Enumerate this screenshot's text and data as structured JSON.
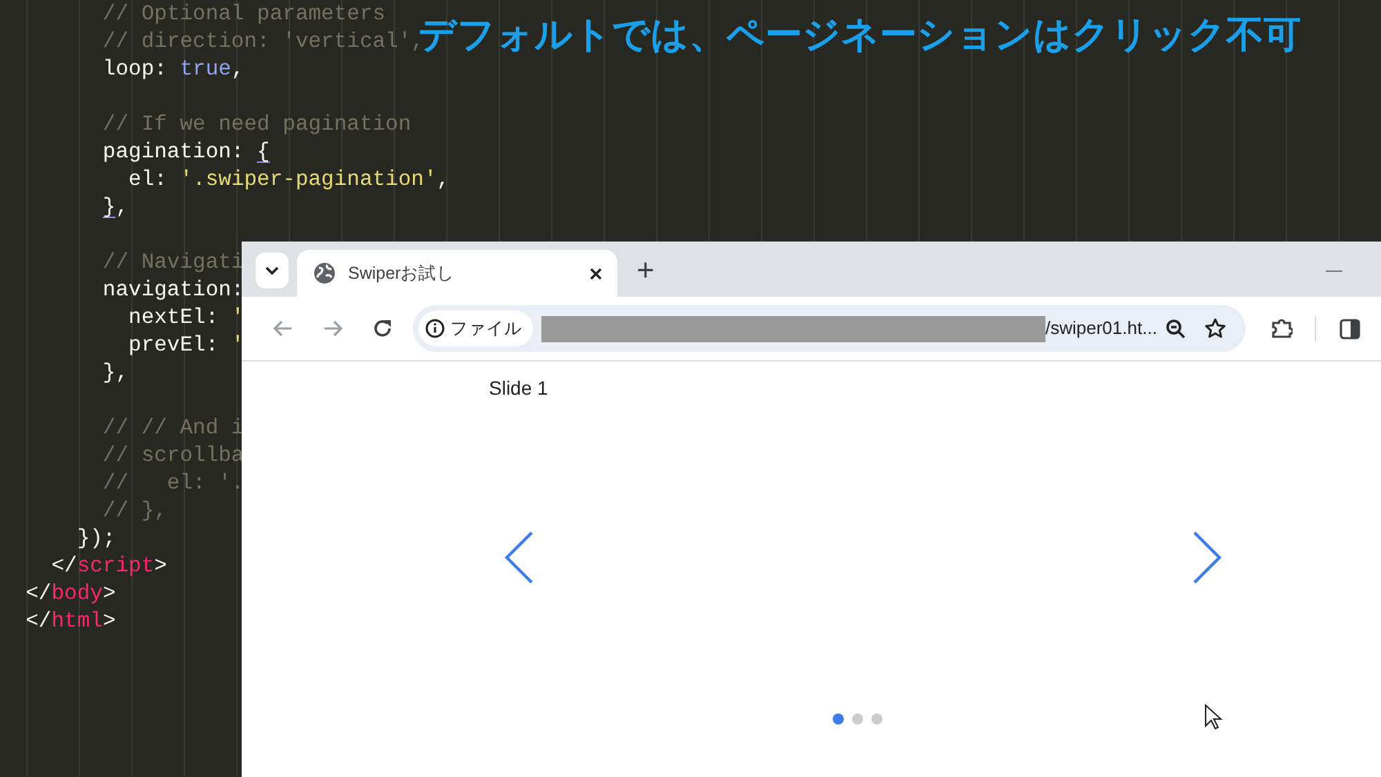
{
  "editor": {
    "lines": [
      {
        "kind": "code",
        "tokens": [
          {
            "kind": "comment",
            "text": "        // Optional parameters"
          }
        ]
      },
      {
        "kind": "code",
        "tokens": [
          {
            "kind": "comment",
            "text": "        // direction: 'vertical',"
          }
        ]
      },
      {
        "kind": "code",
        "tokens": [
          {
            "kind": "plain",
            "text": "        loop: "
          },
          {
            "kind": "keyword",
            "text": "true"
          },
          {
            "kind": "plain",
            "text": ","
          }
        ]
      },
      {
        "kind": "blank"
      },
      {
        "kind": "code",
        "tokens": [
          {
            "kind": "comment",
            "text": "        // If we need pagination"
          }
        ]
      },
      {
        "kind": "code",
        "tokens": [
          {
            "kind": "plain",
            "text": "        pagination: "
          },
          {
            "kind": "match",
            "text": "{"
          }
        ]
      },
      {
        "kind": "code",
        "tokens": [
          {
            "kind": "plain",
            "text": "          el: "
          },
          {
            "kind": "string",
            "text": "'.swiper-pagination'"
          },
          {
            "kind": "plain",
            "text": ","
          }
        ]
      },
      {
        "kind": "code",
        "tokens": [
          {
            "kind": "match",
            "text": "        }"
          },
          {
            "kind": "plain",
            "text": ","
          }
        ]
      },
      {
        "kind": "blank"
      },
      {
        "kind": "code",
        "tokens": [
          {
            "kind": "comment",
            "text": "        // Navigati"
          }
        ]
      },
      {
        "kind": "code",
        "tokens": [
          {
            "kind": "plain",
            "text": "        navigation:"
          }
        ]
      },
      {
        "kind": "code",
        "tokens": [
          {
            "kind": "plain",
            "text": "          nextEl: "
          },
          {
            "kind": "string",
            "text": "'"
          }
        ]
      },
      {
        "kind": "code",
        "tokens": [
          {
            "kind": "plain",
            "text": "          prevEl: "
          },
          {
            "kind": "string",
            "text": "'"
          }
        ]
      },
      {
        "kind": "code",
        "tokens": [
          {
            "kind": "plain",
            "text": "        },"
          }
        ]
      },
      {
        "kind": "blank"
      },
      {
        "kind": "code",
        "tokens": [
          {
            "kind": "comment",
            "text": "        // // And i"
          }
        ]
      },
      {
        "kind": "code",
        "tokens": [
          {
            "kind": "comment",
            "text": "        // scrollba"
          }
        ]
      },
      {
        "kind": "code",
        "tokens": [
          {
            "kind": "comment",
            "text": "        //   el: '."
          }
        ]
      },
      {
        "kind": "code",
        "tokens": [
          {
            "kind": "comment",
            "text": "        // },"
          }
        ]
      },
      {
        "kind": "code",
        "tokens": [
          {
            "kind": "plain",
            "text": "      });"
          }
        ]
      },
      {
        "kind": "code",
        "tokens": [
          {
            "kind": "plain",
            "text": "    </"
          },
          {
            "kind": "tag",
            "text": "script"
          },
          {
            "kind": "plain",
            "text": ">"
          }
        ]
      },
      {
        "kind": "code",
        "tokens": [
          {
            "kind": "plain",
            "text": "  </"
          },
          {
            "kind": "tag",
            "text": "body"
          },
          {
            "kind": "plain",
            "text": ">"
          }
        ]
      },
      {
        "kind": "code",
        "tokens": [
          {
            "kind": "plain",
            "text": "  </"
          },
          {
            "kind": "tag",
            "text": "html"
          },
          {
            "kind": "plain",
            "text": ">"
          }
        ]
      }
    ]
  },
  "caption": "デフォルトでは、ページネーションはクリック不可",
  "browser": {
    "tabs": [
      {
        "title": "Swiperお試し",
        "selected": true
      }
    ],
    "new_tab": "+",
    "omnibox": {
      "chip": "ファイル",
      "url": "/swiper01.ht..."
    },
    "page": {
      "slide_label": "Slide 1",
      "pagination": [
        {
          "selected": true
        },
        {
          "selected": false
        },
        {
          "selected": false
        }
      ]
    }
  }
}
